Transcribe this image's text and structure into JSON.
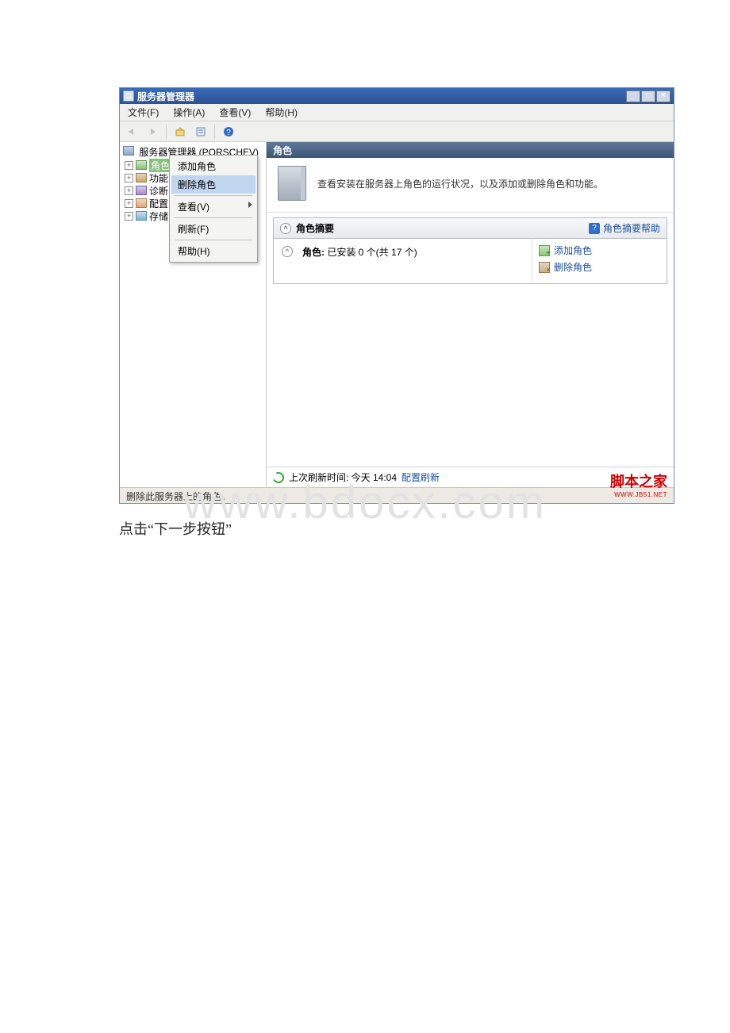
{
  "window": {
    "title": "服务器管理器",
    "min": "_",
    "max": "□",
    "close": "×"
  },
  "menubar": {
    "file": "文件(F)",
    "action": "操作(A)",
    "view": "查看(V)",
    "help": "帮助(H)"
  },
  "toolbar": {
    "back": "⇐",
    "forward": "⇒",
    "up": "",
    "props": "",
    "help": "?"
  },
  "tree": {
    "root": "服务器管理器 (PORSCHEV)",
    "items": [
      {
        "label": "角色"
      },
      {
        "label": "功能"
      },
      {
        "label": "诊断"
      },
      {
        "label": "配置"
      },
      {
        "label": "存储"
      }
    ]
  },
  "context_menu": {
    "add_role": "添加角色",
    "remove_role": "删除角色",
    "view": "查看(V)",
    "refresh": "刷新(F)",
    "help": "帮助(H)"
  },
  "content": {
    "header": "角色",
    "description": "查看安装在服务器上角色的运行状况，以及添加或删除角色和功能。",
    "section_title": "角色摘要",
    "section_help": "角色摘要帮助",
    "roles_label": "角色:",
    "roles_count": "已安装 0 个(共 17 个)",
    "links": {
      "add_role": "添加角色",
      "remove_role": "删除角色"
    },
    "refresh_prefix": "上次刷新时间: 今天 14:04",
    "refresh_link": "配置刷新"
  },
  "statusbar": "删除此服务器上的角色。",
  "brand": {
    "main": "脚本之家",
    "sub": "WWW.JB51.NET"
  },
  "watermark": "www.bdocx.com",
  "caption": "点击“下一步按钮”"
}
